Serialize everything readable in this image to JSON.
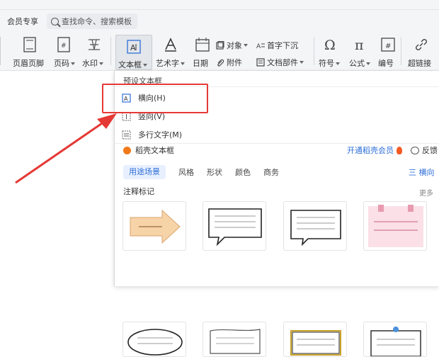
{
  "menubar": {
    "vip": "会员专享",
    "search_placeholder": "查找命令、搜索模板"
  },
  "toolbar": {
    "header_footer": "页眉页脚",
    "page_number": "页码",
    "watermark": "水印",
    "textbox": "文本框",
    "wordart": "艺术字",
    "date": "日期",
    "object": "对象",
    "dropcap": "首字下沉",
    "attachment": "附件",
    "doc_parts": "文档部件",
    "symbol": "符号",
    "formula": "公式",
    "numbering": "编号",
    "hyperlink": "超链接"
  },
  "dropdown": {
    "preset_heading": "预设文本框",
    "horizontal": "横向(H)",
    "vertical": "竖向(V)",
    "multiline": "多行文字(M)",
    "daoke_heading": "稻壳文本框",
    "open_vip": "开通稻壳会员",
    "feedback": "反馈",
    "filters": [
      "用途场景",
      "风格",
      "形状",
      "颜色",
      "商务"
    ],
    "orientation": "三 横向",
    "section_title": "注释标记",
    "more": "更多"
  },
  "colors": {
    "accent": "#2e6fd8",
    "highlight": "#e53935",
    "flame": "#f25b24"
  }
}
